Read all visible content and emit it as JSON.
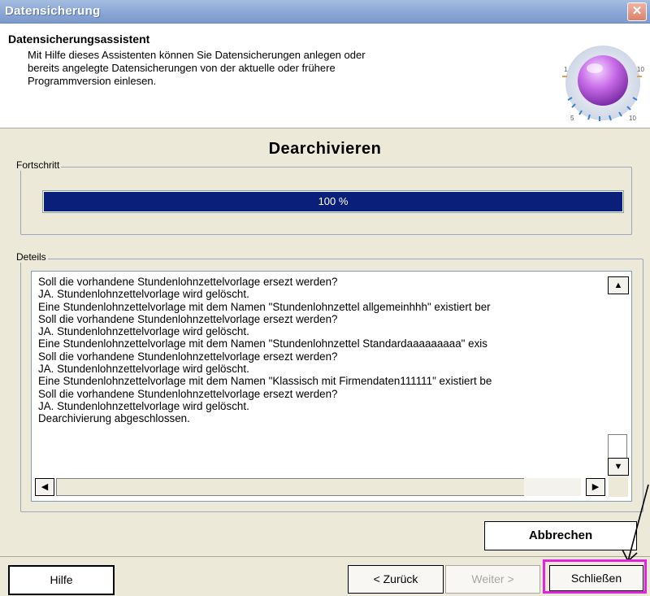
{
  "window": {
    "title": "Datensicherung",
    "close_glyph": "✕"
  },
  "header": {
    "title": "Datensicherungsassistent",
    "description": [
      "Mit Hilfe dieses Assistenten können Sie Datensicherungen anlegen oder",
      "bereits angelegte Datensicherungen von der aktuelle oder frühere",
      "Programmversion einlesen."
    ],
    "icon": "volume-knob-icon",
    "knob_labels": {
      "left": "1",
      "right": "10",
      "bottom_left": "5",
      "bottom_right": "10"
    }
  },
  "section": {
    "heading": "Dearchivieren"
  },
  "progress_group": {
    "legend": "Fortschritt",
    "label": "100 %",
    "value": 1.0,
    "fill_color": "#0a1f7a"
  },
  "details_group": {
    "legend": "Deteils",
    "lines": [
      "Soll die vorhandene Stundenlohnzettelvorlage ersezt werden?",
      "JA. Stundenlohnzettelvorlage wird gelöscht.",
      "Eine Stundenlohnzettelvorlage mit dem Namen \"Stundenlohnzettel allgemeinhhh\" existiert ber",
      "Soll die vorhandene Stundenlohnzettelvorlage ersezt werden?",
      "JA. Stundenlohnzettelvorlage wird gelöscht.",
      "Eine Stundenlohnzettelvorlage mit dem Namen \"Stundenlohnzettel Standardaaaaaaaaa\" exis",
      "Soll die vorhandene Stundenlohnzettelvorlage ersezt werden?",
      "JA. Stundenlohnzettelvorlage wird gelöscht.",
      "Eine Stundenlohnzettelvorlage mit dem Namen \"Klassisch mit Firmendaten111111\" existiert be",
      "Soll die vorhandene Stundenlohnzettelvorlage ersezt werden?",
      "JA. Stundenlohnzettelvorlage wird gelöscht.",
      "Dearchivierung abgeschlossen."
    ]
  },
  "buttons": {
    "cancel": "Abbrechen",
    "help": "Hilfe",
    "back": "< Zurück",
    "next": "Weiter >",
    "close": "Schließen"
  },
  "colors": {
    "highlight": "#e223e0",
    "dialog_bg": "#ece9d8"
  }
}
